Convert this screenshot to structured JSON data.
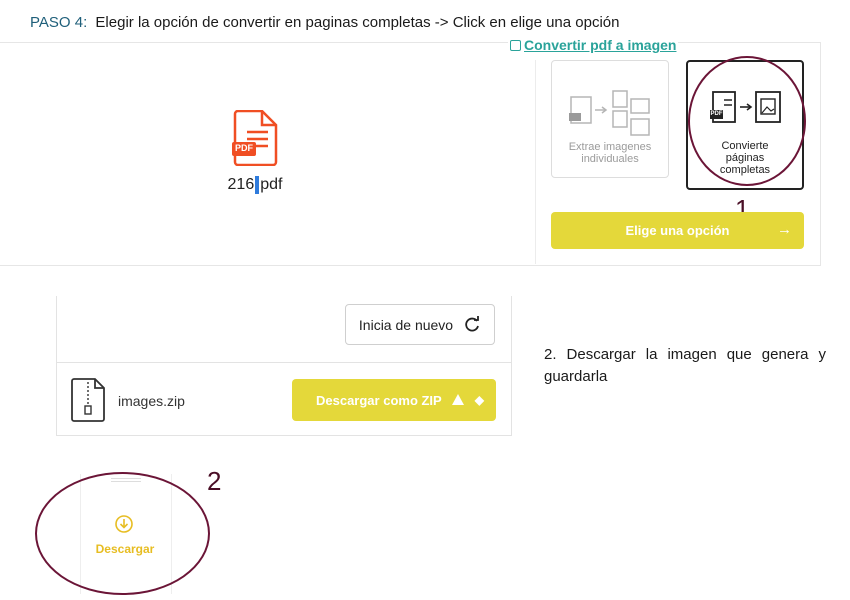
{
  "step1": {
    "label": "PASO 4:",
    "text": "Elegir la opción de convertir en paginas completas -> Click en elige una opción"
  },
  "convert_link": "Convertir pdf a imagen",
  "file": {
    "badge": "PDF",
    "name_part1": "216",
    "name_part2": "pdf"
  },
  "options": {
    "extract_label": "Extrae imagenes individuales",
    "pages_label": "Convierte páginas completas",
    "pdf_mini_badge": "PDF"
  },
  "choose_button": {
    "label": "Elige una opción",
    "arrow": "→"
  },
  "annotation_1": "1",
  "restart_button": "Inicia de nuevo",
  "zip": {
    "filename": "images.zip",
    "download_label": "Descargar como ZIP"
  },
  "step2": {
    "text": "2. Descargar la imagen que genera y guardarla"
  },
  "annotation_2": "2",
  "download": {
    "label": "Descargar"
  },
  "colors": {
    "accent_yellow": "#e4d83a",
    "annotation_circle": "#6b1537",
    "pdf_red": "#f04e23",
    "link_teal": "#2aa39a",
    "download_gold": "#e7bd22"
  }
}
